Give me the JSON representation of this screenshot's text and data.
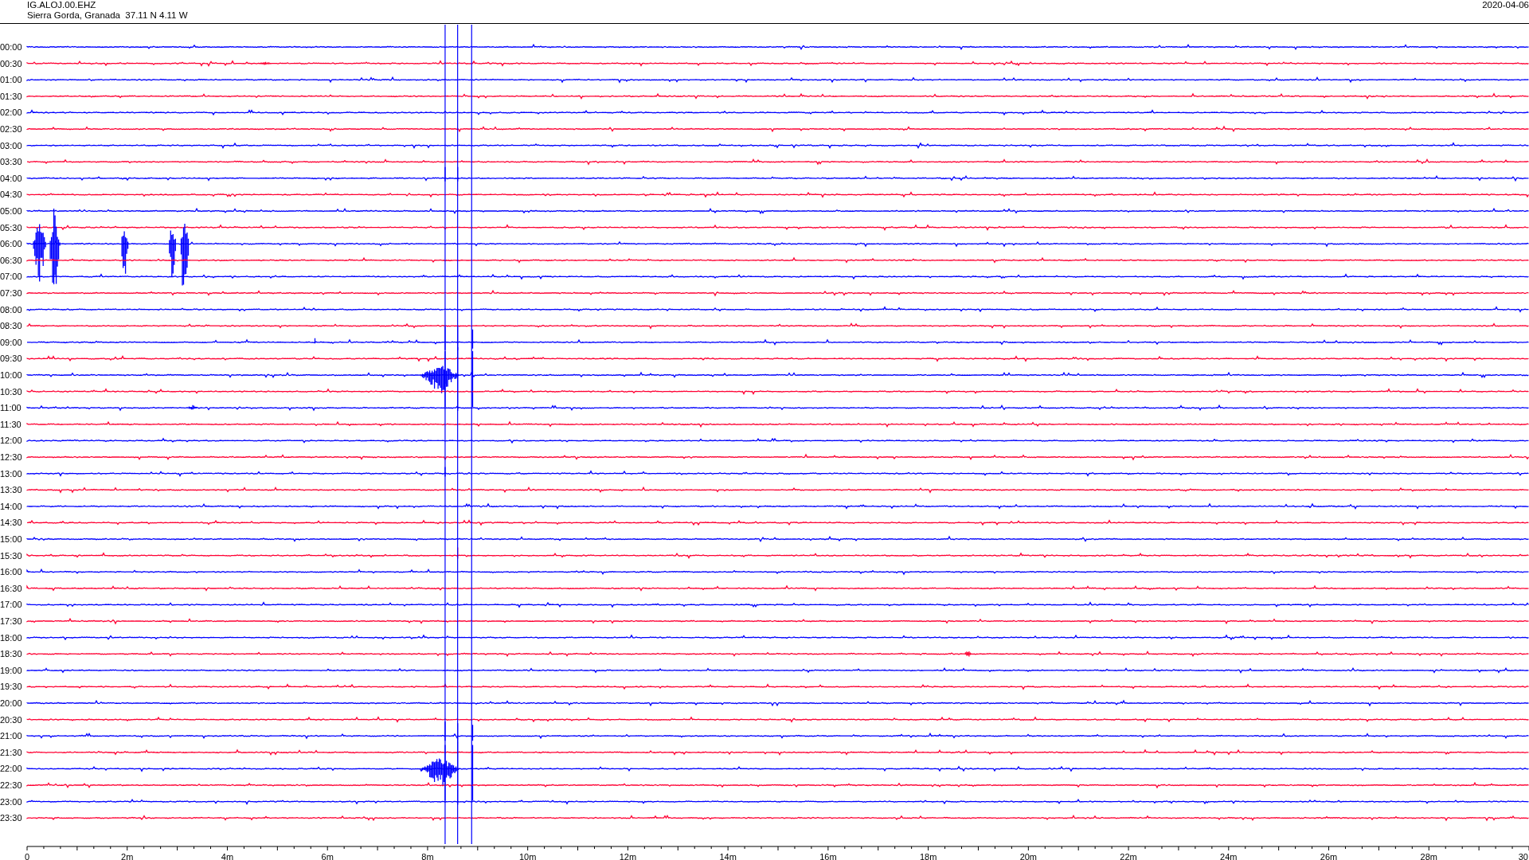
{
  "header": {
    "station": "IG.ALOJ.00.EHZ",
    "location": "Sierra Gorda, Granada  37.11 N 4.11 W",
    "date": "2020-04-06"
  },
  "rows": [
    {
      "label": "00:00",
      "color": "#0000ff"
    },
    {
      "label": "00:30",
      "color": "#ff0033"
    },
    {
      "label": "01:00",
      "color": "#0000ff"
    },
    {
      "label": "01:30",
      "color": "#ff0033"
    },
    {
      "label": "02:00",
      "color": "#0000ff"
    },
    {
      "label": "02:30",
      "color": "#ff0033"
    },
    {
      "label": "03:00",
      "color": "#0000ff"
    },
    {
      "label": "03:30",
      "color": "#ff0033"
    },
    {
      "label": "04:00",
      "color": "#0000ff"
    },
    {
      "label": "04:30",
      "color": "#ff0033"
    },
    {
      "label": "05:00",
      "color": "#0000ff"
    },
    {
      "label": "05:30",
      "color": "#ff0033"
    },
    {
      "label": "06:00",
      "color": "#0000ff"
    },
    {
      "label": "06:30",
      "color": "#ff0033"
    },
    {
      "label": "07:00",
      "color": "#0000ff"
    },
    {
      "label": "07:30",
      "color": "#ff0033"
    },
    {
      "label": "08:00",
      "color": "#0000ff"
    },
    {
      "label": "08:30",
      "color": "#ff0033"
    },
    {
      "label": "09:00",
      "color": "#0000ff"
    },
    {
      "label": "09:30",
      "color": "#ff0033"
    },
    {
      "label": "10:00",
      "color": "#0000ff"
    },
    {
      "label": "10:30",
      "color": "#ff0033"
    },
    {
      "label": "11:00",
      "color": "#0000ff"
    },
    {
      "label": "11:30",
      "color": "#ff0033"
    },
    {
      "label": "12:00",
      "color": "#0000ff"
    },
    {
      "label": "12:30",
      "color": "#ff0033"
    },
    {
      "label": "13:00",
      "color": "#0000ff"
    },
    {
      "label": "13:30",
      "color": "#ff0033"
    },
    {
      "label": "14:00",
      "color": "#0000ff"
    },
    {
      "label": "14:30",
      "color": "#ff0033"
    },
    {
      "label": "15:00",
      "color": "#0000ff"
    },
    {
      "label": "15:30",
      "color": "#ff0033"
    },
    {
      "label": "16:00",
      "color": "#0000ff"
    },
    {
      "label": "16:30",
      "color": "#ff0033"
    },
    {
      "label": "17:00",
      "color": "#0000ff"
    },
    {
      "label": "17:30",
      "color": "#ff0033"
    },
    {
      "label": "18:00",
      "color": "#0000ff"
    },
    {
      "label": "18:30",
      "color": "#ff0033"
    },
    {
      "label": "19:00",
      "color": "#0000ff"
    },
    {
      "label": "19:30",
      "color": "#ff0033"
    },
    {
      "label": "20:00",
      "color": "#0000ff"
    },
    {
      "label": "20:30",
      "color": "#ff0033"
    },
    {
      "label": "21:00",
      "color": "#0000ff"
    },
    {
      "label": "21:30",
      "color": "#ff0033"
    },
    {
      "label": "22:00",
      "color": "#0000ff"
    },
    {
      "label": "22:30",
      "color": "#ff0033"
    },
    {
      "label": "23:00",
      "color": "#0000ff"
    },
    {
      "label": "23:30",
      "color": "#ff0033"
    }
  ],
  "x_axis": {
    "labels": [
      "0",
      "2m",
      "4m",
      "6m",
      "8m",
      "10m",
      "12m",
      "14m",
      "16m",
      "18m",
      "20m",
      "22m",
      "24m",
      "26m",
      "28m",
      "30"
    ]
  }
}
